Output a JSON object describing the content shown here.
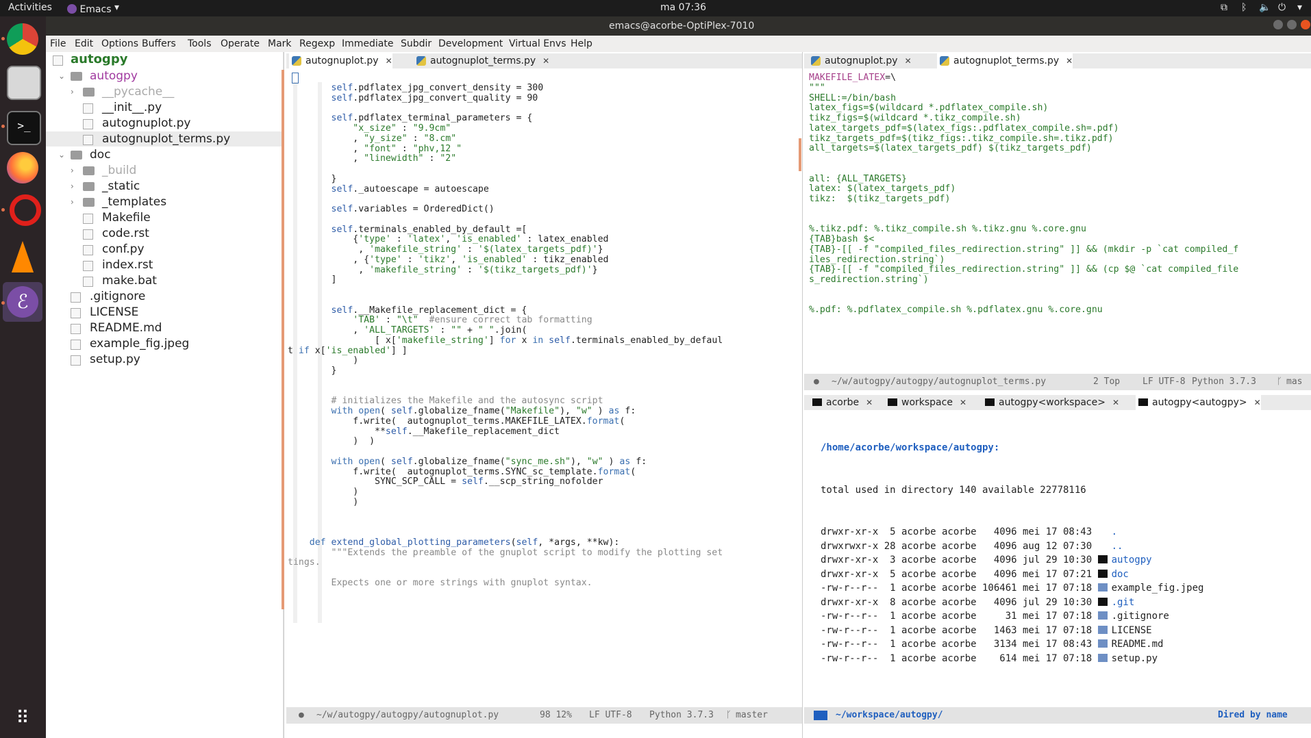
{
  "topbar": {
    "activities": "Activities",
    "app": "Emacs",
    "clock": "ma 07:36"
  },
  "window": {
    "title": "emacs@acorbe-OptiPlex-7010"
  },
  "menu": [
    "File",
    "Edit",
    "Options",
    "Buffers",
    "Tools",
    "Operate",
    "Mark",
    "Regexp",
    "Immediate",
    "Subdir",
    "Development",
    "Virtual Envs",
    "Help"
  ],
  "sidebar": {
    "root": "autogpy",
    "items": [
      "autogpy",
      "__pycache__",
      "__init__.py",
      "autognuplot.py",
      "autognuplot_terms.py",
      "doc",
      "_build",
      "_static",
      "_templates",
      "Makefile",
      "code.rst",
      "conf.py",
      "index.rst",
      "make.bat",
      ".gitignore",
      "LICENSE",
      "README.md",
      "example_fig.jpeg",
      "setup.py"
    ]
  },
  "left_editor": {
    "tabs": [
      "autognuplot.py",
      "autognuplot_terms.py"
    ],
    "modeline": {
      "path": "~/w/autogpy/autogpy/autognuplot.py",
      "pos": "98 12%",
      "enc": "LF UTF-8",
      "lang": "Python 3.7.3",
      "branch": "master"
    }
  },
  "right_editor": {
    "tabs": [
      "autognuplot.py",
      "autognuplot_terms.py"
    ],
    "modeline": {
      "path": "~/w/autogpy/autogpy/autognuplot_terms.py",
      "pos": "2 Top",
      "enc": "LF UTF-8",
      "lang": "Python 3.7.3",
      "branch": "mas"
    }
  },
  "dired": {
    "tabs": [
      "acorbe",
      "workspace",
      "autogpy<workspace>",
      "autogpy<autogpy>"
    ],
    "header": "/home/acorbe/workspace/autogpy:",
    "total": "total used in directory 140 available 22778116",
    "rows": [
      {
        "perm": "drwxr-xr-x",
        "n": "5",
        "owner": "acorbe",
        "group": "acorbe",
        "size": "4096",
        "date": "mei 17 08:43",
        "name": "."
      },
      {
        "perm": "drwxrwxr-x",
        "n": "28",
        "owner": "acorbe",
        "group": "acorbe",
        "size": "4096",
        "date": "aug 12 07:30",
        "name": ".."
      },
      {
        "perm": "drwxr-xr-x",
        "n": "3",
        "owner": "acorbe",
        "group": "acorbe",
        "size": "4096",
        "date": "jul 29 10:30",
        "name": "autogpy"
      },
      {
        "perm": "drwxr-xr-x",
        "n": "5",
        "owner": "acorbe",
        "group": "acorbe",
        "size": "4096",
        "date": "mei 17 07:21",
        "name": "doc"
      },
      {
        "perm": "-rw-r--r--",
        "n": "1",
        "owner": "acorbe",
        "group": "acorbe",
        "size": "106461",
        "date": "mei 17 07:18",
        "name": "example_fig.jpeg"
      },
      {
        "perm": "drwxr-xr-x",
        "n": "8",
        "owner": "acorbe",
        "group": "acorbe",
        "size": "4096",
        "date": "jul 29 10:30",
        "name": ".git"
      },
      {
        "perm": "-rw-r--r--",
        "n": "1",
        "owner": "acorbe",
        "group": "acorbe",
        "size": "31",
        "date": "mei 17 07:18",
        "name": ".gitignore"
      },
      {
        "perm": "-rw-r--r--",
        "n": "1",
        "owner": "acorbe",
        "group": "acorbe",
        "size": "1463",
        "date": "mei 17 07:18",
        "name": "LICENSE"
      },
      {
        "perm": "-rw-r--r--",
        "n": "1",
        "owner": "acorbe",
        "group": "acorbe",
        "size": "3134",
        "date": "mei 17 08:43",
        "name": "README.md"
      },
      {
        "perm": "-rw-r--r--",
        "n": "1",
        "owner": "acorbe",
        "group": "acorbe",
        "size": "614",
        "date": "mei 17 07:18",
        "name": "setup.py"
      }
    ],
    "modeline": {
      "path": "~/workspace/autogpy/",
      "mode": "Dired by name"
    }
  },
  "colors": {
    "accent": "#e95420",
    "dir": "#1f5fbf",
    "string": "#2b7a2b",
    "keyword": "#3a6fb0"
  }
}
